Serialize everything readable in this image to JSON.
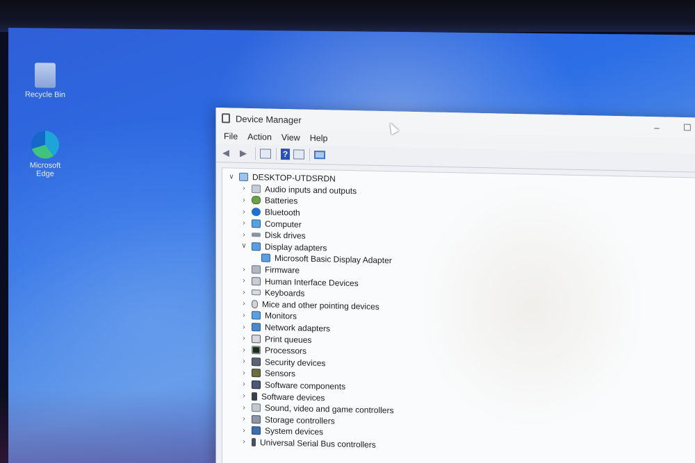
{
  "desktop": {
    "icons": [
      {
        "label": "Recycle Bin"
      },
      {
        "label": "Microsoft Edge"
      }
    ]
  },
  "window": {
    "title": "Device Manager",
    "controls": {
      "minimize": "–",
      "maximize": "☐"
    },
    "menu": [
      "File",
      "Action",
      "View",
      "Help"
    ],
    "toolbar": {
      "back_icon": "back-arrow-icon",
      "forward_icon": "forward-arrow-icon",
      "properties_icon": "properties-icon",
      "help_icon": "help-icon",
      "scan_icon": "scan-hardware-icon"
    }
  },
  "tree": {
    "root": "DESKTOP-UTDSRDN",
    "items": [
      {
        "label": "Audio inputs and outputs",
        "icon": "speaker-icon",
        "expanded": false
      },
      {
        "label": "Batteries",
        "icon": "battery-icon",
        "expanded": false
      },
      {
        "label": "Bluetooth",
        "icon": "bluetooth-icon",
        "expanded": false
      },
      {
        "label": "Computer",
        "icon": "computer-icon",
        "expanded": false
      },
      {
        "label": "Disk drives",
        "icon": "disk-icon",
        "expanded": false
      },
      {
        "label": "Display adapters",
        "icon": "monitor-icon",
        "expanded": true
      },
      {
        "label": "Microsoft Basic Display Adapter",
        "icon": "monitor-icon",
        "child": true
      },
      {
        "label": "Firmware",
        "icon": "firmware-icon",
        "expanded": false
      },
      {
        "label": "Human Interface Devices",
        "icon": "hid-icon",
        "expanded": false
      },
      {
        "label": "Keyboards",
        "icon": "keyboard-icon",
        "expanded": false
      },
      {
        "label": "Mice and other pointing devices",
        "icon": "mouse-icon",
        "expanded": false
      },
      {
        "label": "Monitors",
        "icon": "monitor-icon",
        "expanded": false
      },
      {
        "label": "Network adapters",
        "icon": "network-icon",
        "expanded": false
      },
      {
        "label": "Print queues",
        "icon": "printer-icon",
        "expanded": false
      },
      {
        "label": "Processors",
        "icon": "cpu-icon",
        "expanded": false
      },
      {
        "label": "Security devices",
        "icon": "security-icon",
        "expanded": false
      },
      {
        "label": "Sensors",
        "icon": "sensor-icon",
        "expanded": false
      },
      {
        "label": "Software components",
        "icon": "component-icon",
        "expanded": false
      },
      {
        "label": "Software devices",
        "icon": "software-device-icon",
        "expanded": false
      },
      {
        "label": "Sound, video and game controllers",
        "icon": "sound-icon",
        "expanded": false
      },
      {
        "label": "Storage controllers",
        "icon": "storage-icon",
        "expanded": false
      },
      {
        "label": "System devices",
        "icon": "system-icon",
        "expanded": false
      },
      {
        "label": "Universal Serial Bus controllers",
        "icon": "usb-icon",
        "expanded": false
      }
    ]
  }
}
